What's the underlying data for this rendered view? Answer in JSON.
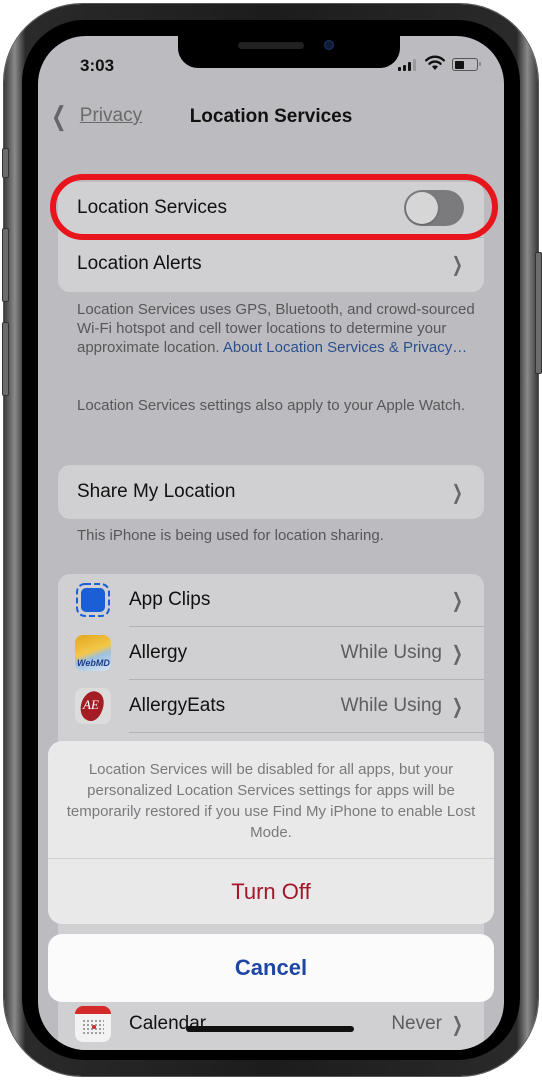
{
  "status_bar": {
    "time": "3:03"
  },
  "nav": {
    "back_label": "Privacy",
    "title": "Location Services"
  },
  "location_group": {
    "toggle_label": "Location Services",
    "toggle_on": false,
    "alerts_label": "Location Alerts"
  },
  "description": {
    "text": "Location Services uses GPS, Bluetooth, and crowd-sourced Wi-Fi hotspot and cell tower locations to determine your approximate location. ",
    "link": "About Location Services & Privacy…",
    "watch_note": "Location Services settings also apply to your Apple Watch."
  },
  "share": {
    "label": "Share My Location",
    "footer": "This iPhone is being used for location sharing."
  },
  "apps": [
    {
      "name": "App Clips",
      "value": "",
      "icon": "app-clips-icon"
    },
    {
      "name": "Allergy",
      "value": "While Using",
      "icon": "webmd-allergy-icon"
    },
    {
      "name": "AllergyEats",
      "value": "While Using",
      "icon": "allergyeats-icon"
    },
    {
      "name": "Calendar",
      "value": "Never",
      "icon": "calendar-icon"
    }
  ],
  "action_sheet": {
    "message": "Location Services will be disabled for all apps, but your personalized Location Services settings for apps will be temporarily restored if you use Find My iPhone to enable Lost Mode.",
    "destructive_label": "Turn Off",
    "cancel_label": "Cancel"
  },
  "colors": {
    "highlight": "#e8161c",
    "destructive": "#a3172a",
    "link": "#1e46a6"
  }
}
